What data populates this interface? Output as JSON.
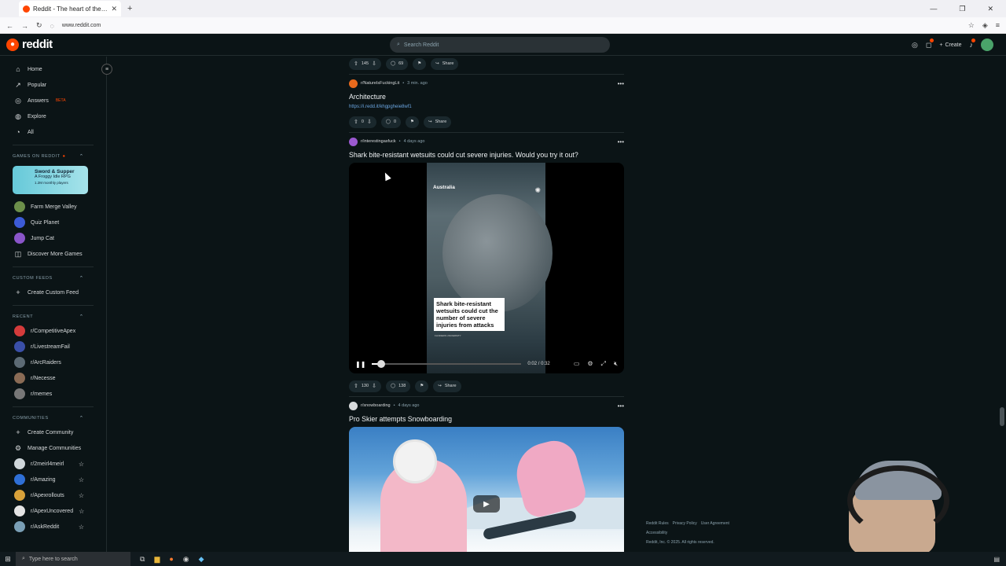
{
  "browser": {
    "tab_title": "Reddit - The heart of the internet",
    "url": "www.reddit.com",
    "newtab": "+",
    "close": "✕"
  },
  "header": {
    "logo_text": "reddit",
    "search_placeholder": "Search Reddit",
    "create_label": "Create"
  },
  "sidebar": {
    "main": [
      {
        "label": "Home",
        "icon": "⌂"
      },
      {
        "label": "Popular",
        "icon": "↗"
      },
      {
        "label": "Answers",
        "icon": "◎",
        "badge": "BETA"
      },
      {
        "label": "Explore",
        "icon": "◍"
      },
      {
        "label": "All",
        "icon": "◔"
      }
    ],
    "games_title": "GAMES ON REDDIT",
    "game_card": {
      "title": "Sword & Supper",
      "subtitle": "A Froggy Idle RPG",
      "players": "1.2M monthly players"
    },
    "games": [
      {
        "label": "Farm Merge Valley",
        "color": "#6c8f4a"
      },
      {
        "label": "Quiz Planet",
        "color": "#3c5ad6"
      },
      {
        "label": "Jump Cat",
        "color": "#8a55c9"
      },
      {
        "label": "Discover More Games",
        "icon": "◫"
      }
    ],
    "custom_title": "CUSTOM FEEDS",
    "custom_items": [
      {
        "label": "Create Custom Feed",
        "icon": "+"
      }
    ],
    "recent_title": "RECENT",
    "recent": [
      {
        "label": "r/CompetitiveApex",
        "color": "#d43b3b"
      },
      {
        "label": "r/LivestreamFail",
        "color": "#3a4fa8"
      },
      {
        "label": "r/ArcRaiders",
        "color": "#5c6a74"
      },
      {
        "label": "r/Necesse",
        "color": "#8a6b55"
      },
      {
        "label": "r/memes",
        "color": "#777"
      }
    ],
    "communities_title": "COMMUNITIES",
    "community_actions": [
      {
        "label": "Create Community",
        "icon": "+"
      },
      {
        "label": "Manage Communities",
        "icon": "⚙"
      }
    ],
    "communities": [
      {
        "label": "r/2meirl4meirl",
        "color": "#cfd6da"
      },
      {
        "label": "r/Amazing",
        "color": "#2f6fd6"
      },
      {
        "label": "r/Apexrollouts",
        "color": "#d8a13a"
      },
      {
        "label": "r/ApexUncovered",
        "color": "#e4e4e4"
      },
      {
        "label": "r/AskReddit",
        "color": "#7a9fb5"
      }
    ],
    "star": "☆"
  },
  "feed": {
    "top_actions": {
      "votes": "145",
      "comments": "69",
      "share": "Share"
    },
    "post1": {
      "subreddit": "r/NatureIsFuckingLit",
      "time": "3 min. ago",
      "title": "Architecture",
      "link": "https://i.redd.it/khgpgheie8wf1",
      "votes": "0",
      "comments": "0",
      "share": "Share",
      "avatar_color": "#e8691c"
    },
    "post2": {
      "subreddit": "r/interestingasfuck",
      "time": "4 days ago",
      "title": "Shark bite-resistant wetsuits could cut severe injuries. Would you try it out?",
      "video_location": "Australia",
      "video_caption": "Shark bite-resistant wetsuits could cut the number of severe injuries from attacks",
      "video_source": "FLINDERS UNIVERSITY",
      "video_time": "0:02 / 0:32",
      "progress": 0.06,
      "votes": "130",
      "comments": "138",
      "share": "Share",
      "avatar_color": "#9b59d0"
    },
    "post3": {
      "subreddit": "r/snowboarding",
      "time": "4 days ago",
      "title": "Pro Skier attempts Snowboarding",
      "avatar_color": "#d7dadc"
    },
    "separator": "•"
  },
  "footer": {
    "links": [
      "Reddit Rules",
      "Privacy Policy",
      "User Agreement"
    ],
    "accessibility": "Accessibility",
    "copyright": "Reddit, Inc. © 2025. All rights reserved."
  },
  "taskbar": {
    "search_placeholder": "Type here to search"
  }
}
